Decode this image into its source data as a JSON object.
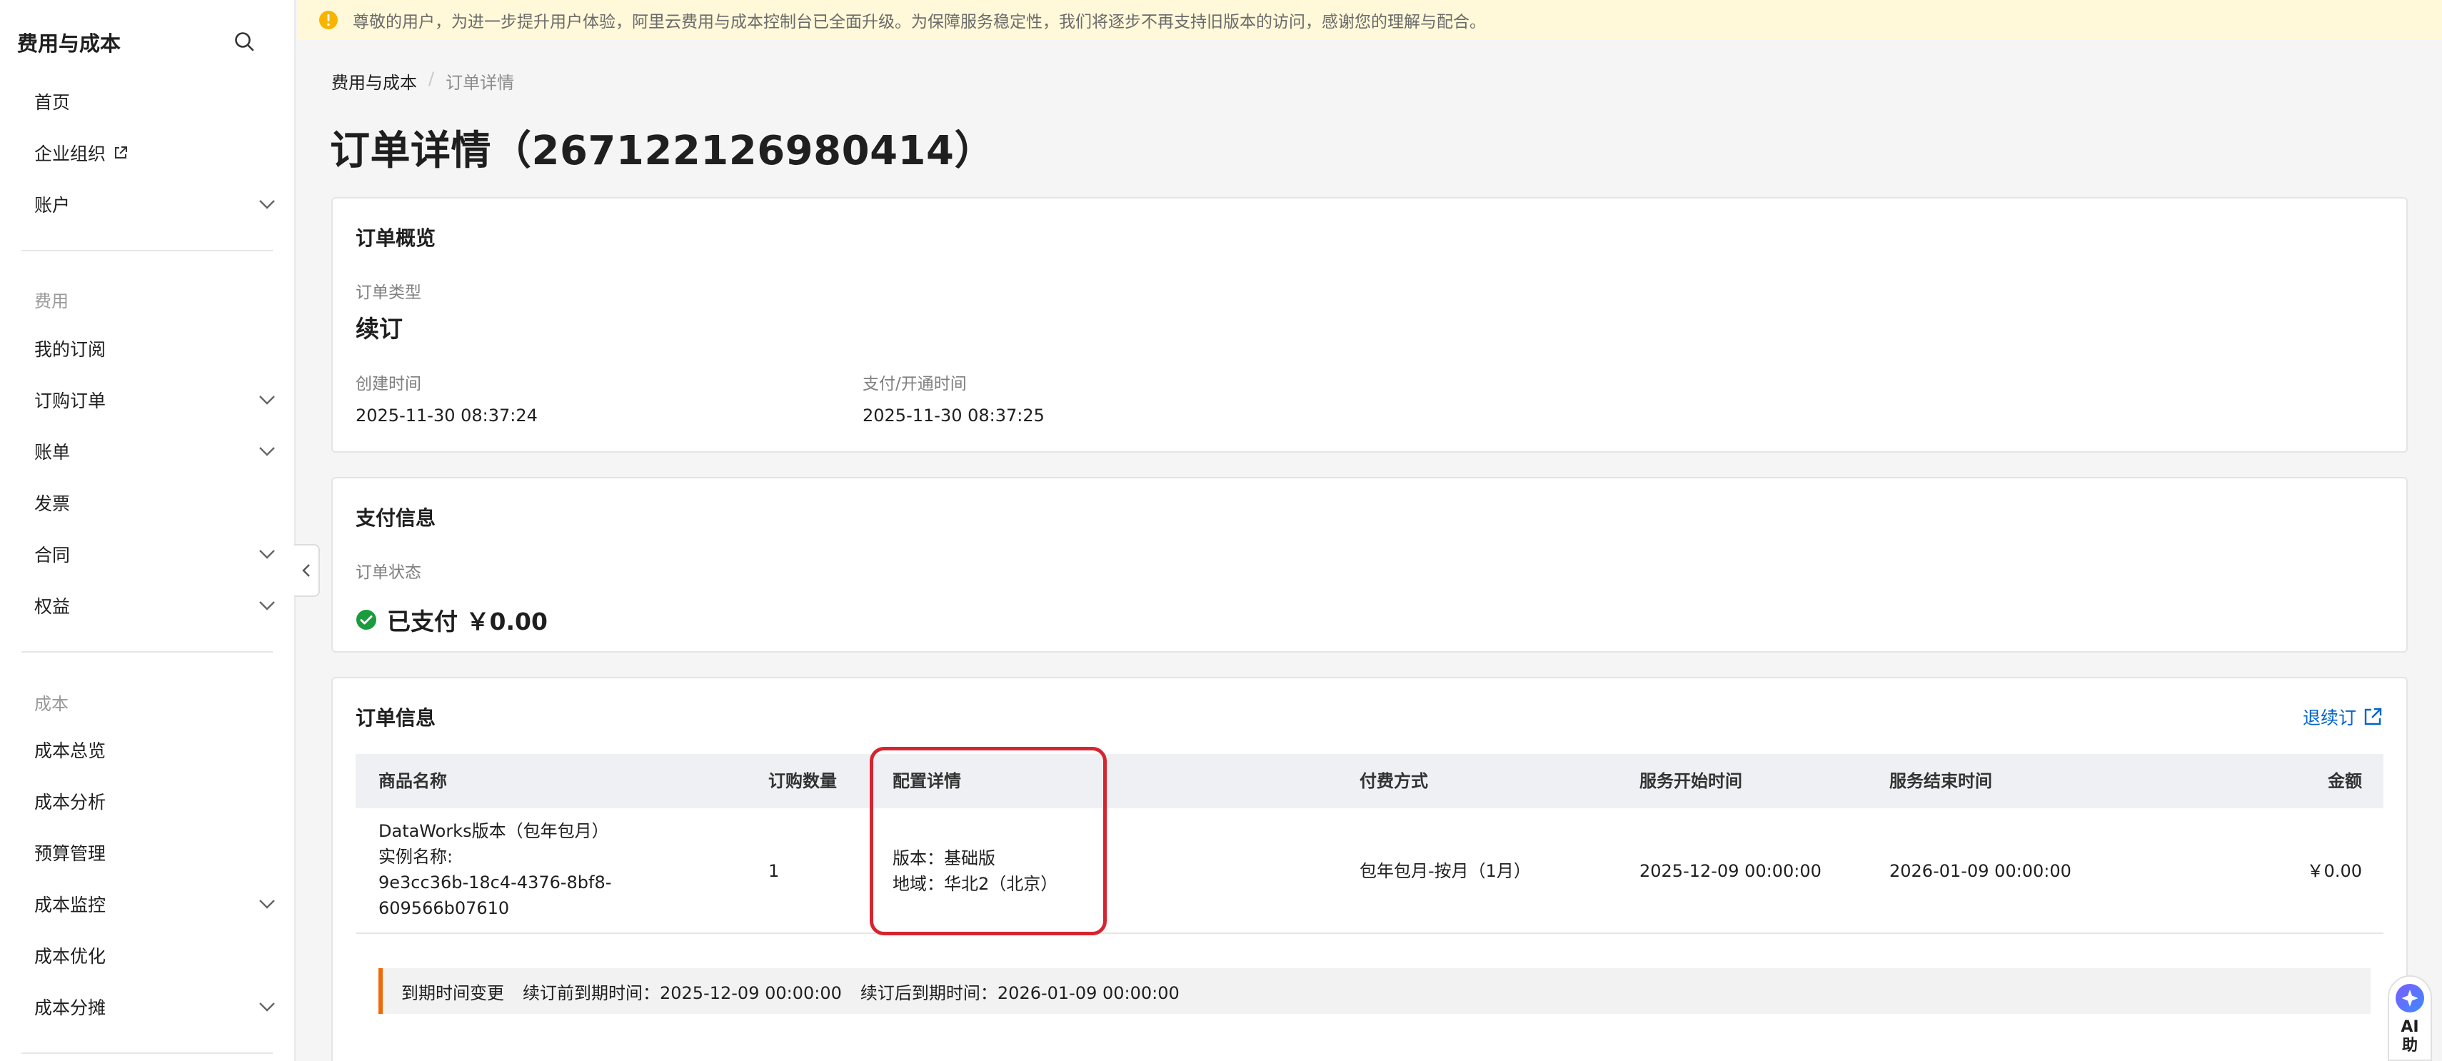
{
  "sidebar": {
    "title": "费用与成本",
    "top_items": [
      {
        "label": "首页"
      },
      {
        "label": "企业组织"
      },
      {
        "label": "账户"
      }
    ],
    "section_fees": "费用",
    "fee_items": [
      {
        "label": "我的订阅"
      },
      {
        "label": "订购订单"
      },
      {
        "label": "账单"
      },
      {
        "label": "发票"
      },
      {
        "label": "合同"
      },
      {
        "label": "权益"
      }
    ],
    "section_cost": "成本",
    "cost_items": [
      {
        "label": "成本总览"
      },
      {
        "label": "成本分析"
      },
      {
        "label": "预算管理"
      },
      {
        "label": "成本监控"
      },
      {
        "label": "成本优化"
      },
      {
        "label": "成本分摊"
      }
    ]
  },
  "notice": {
    "text": "尊敬的用户，为进一步提升用户体验，阿里云费用与成本控制台已全面升级。为保障服务稳定性，我们将逐步不再支持旧版本的访问，感谢您的理解与配合。"
  },
  "breadcrumb": {
    "root": "费用与成本",
    "separator": "/",
    "current": "订单详情"
  },
  "page_title": "订单详情（267122126980414）",
  "overview": {
    "title": "订单概览",
    "type_label": "订单类型",
    "type_value": "续订",
    "created_label": "创建时间",
    "created_value": "2025-11-30 08:37:24",
    "paid_label": "支付/开通时间",
    "paid_value": "2025-11-30 08:37:25"
  },
  "payment": {
    "title": "支付信息",
    "status_label": "订单状态",
    "status_value": "已支付 ￥0.00"
  },
  "order_info": {
    "title": "订单信息",
    "renew_link": "退续订",
    "columns": [
      "商品名称",
      "订购数量",
      "配置详情",
      "付费方式",
      "服务开始时间",
      "服务结束时间",
      "金额"
    ],
    "row": {
      "product_line1": "DataWorks版本（包年包月）",
      "product_line2": "实例名称:",
      "product_line3": "9e3cc36b-18c4-4376-8bf8-",
      "product_line4": "609566b07610",
      "quantity": "1",
      "config_line1": "版本：基础版",
      "config_line2": "地域：华北2（北京）",
      "billing": "包年包月-按月（1月）",
      "start": "2025-12-09 00:00:00",
      "end": "2026-01-09 00:00:00",
      "amount": "￥0.00"
    },
    "change": {
      "label": "到期时间变更",
      "before": "续订前到期时间：2025-12-09 00:00:00",
      "after": "续订后到期时间：2026-01-09 00:00:00"
    }
  },
  "ai_assistant": {
    "label_line1": "AI",
    "label_line2": "助"
  },
  "colors": {
    "accent_link": "#0064c8",
    "success": "#1a9b3c",
    "highlight": "#d6252f",
    "change_bar": "#ed6a0c",
    "notice_bg": "#fff8d9"
  }
}
